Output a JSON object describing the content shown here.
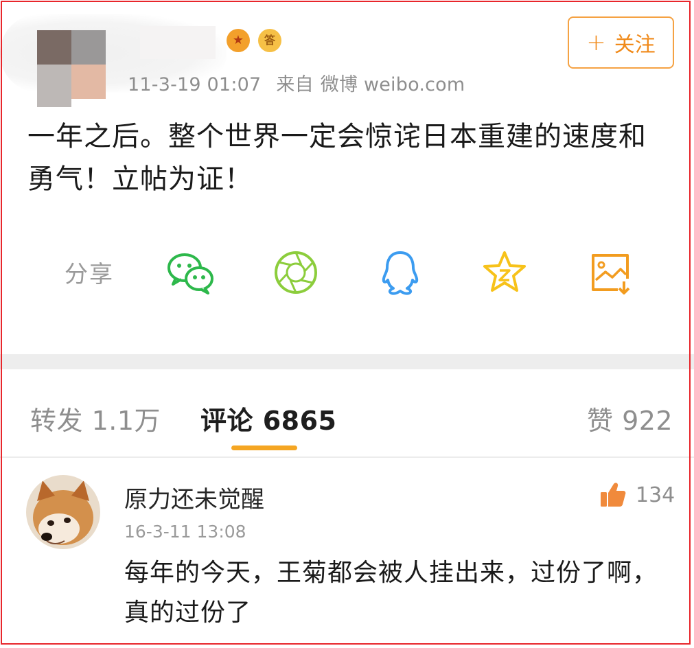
{
  "post": {
    "meta": {
      "datetime": "11-3-19 01:07",
      "source_prefix": "来自",
      "source": "微博 weibo.com"
    },
    "badges": {
      "badge_1": "★",
      "badge_2": "答"
    },
    "follow_label": "关注",
    "follow_plus": "+",
    "text": "一年之后。整个世界一定会惊诧日本重建的速度和勇气！立帖为证！"
  },
  "share": {
    "label": "分享",
    "icons": [
      "wechat-icon",
      "moments-icon",
      "qq-icon",
      "qzone-icon",
      "save-image-icon"
    ]
  },
  "tabs": {
    "repost": "转发 1.1万",
    "comment": "评论 6865",
    "like": "赞 922"
  },
  "comment": {
    "username": "原力还未觉醒",
    "time": "16-3-11 13:08",
    "likes": "134",
    "text": "每年的今天，王菊都会被人挂出来，过份了啊，真的过份了"
  },
  "colors": {
    "accent": "#f5a623",
    "frame": "#e8262b",
    "wechat": "#2db84b",
    "moments": "#8ccd3c",
    "qq": "#3c9cf0",
    "qzone": "#f7c21a",
    "save": "#f29c1f"
  }
}
